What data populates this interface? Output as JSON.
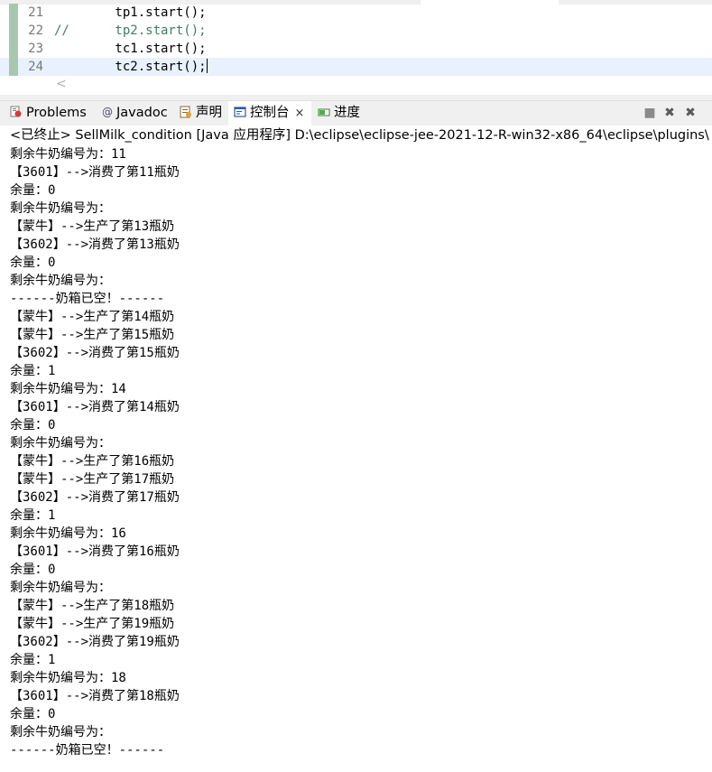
{
  "editor": {
    "lines": [
      {
        "num": "21",
        "prefix": "",
        "code": "        tp1.start();",
        "commented": false
      },
      {
        "num": "22",
        "prefix": "//",
        "code": "      tp2.start();",
        "commented": true
      },
      {
        "num": "23",
        "prefix": "",
        "code": "        tc1.start();",
        "commented": false
      },
      {
        "num": "24",
        "prefix": "",
        "code": "        tc2.start();",
        "commented": false
      }
    ],
    "scroll_left": "<"
  },
  "tabs": {
    "problems": "Problems",
    "javadoc": "Javadoc",
    "declaration": "声明",
    "console": "控制台",
    "console_close": "×",
    "progress": "进度"
  },
  "toolbar": {
    "stop": "■",
    "remove": "✖",
    "remove_all": "✖"
  },
  "status": "<已终止> SellMilk_condition [Java 应用程序] D:\\eclipse\\eclipse-jee-2021-12-R-win32-x86_64\\eclipse\\plugins\\",
  "console_lines": [
    "剩余牛奶编号为：11",
    "【3601】-->消费了第11瓶奶",
    "余量：0",
    "剩余牛奶编号为：",
    "【蒙牛】-->生产了第13瓶奶",
    "【3602】-->消费了第13瓶奶",
    "余量：0",
    "剩余牛奶编号为：",
    "------奶箱已空！------",
    "【蒙牛】-->生产了第14瓶奶",
    "【蒙牛】-->生产了第15瓶奶",
    "【3602】-->消费了第15瓶奶",
    "余量：1",
    "剩余牛奶编号为：14",
    "【3601】-->消费了第14瓶奶",
    "余量：0",
    "剩余牛奶编号为：",
    "【蒙牛】-->生产了第16瓶奶",
    "【蒙牛】-->生产了第17瓶奶",
    "【3602】-->消费了第17瓶奶",
    "余量：1",
    "剩余牛奶编号为：16",
    "【3601】-->消费了第16瓶奶",
    "余量：0",
    "剩余牛奶编号为：",
    "【蒙牛】-->生产了第18瓶奶",
    "【蒙牛】-->生产了第19瓶奶",
    "【3602】-->消费了第19瓶奶",
    "余量：1",
    "剩余牛奶编号为：18",
    "【3601】-->消费了第18瓶奶",
    "余量：0",
    "剩余牛奶编号为：",
    "------奶箱已空！------"
  ]
}
